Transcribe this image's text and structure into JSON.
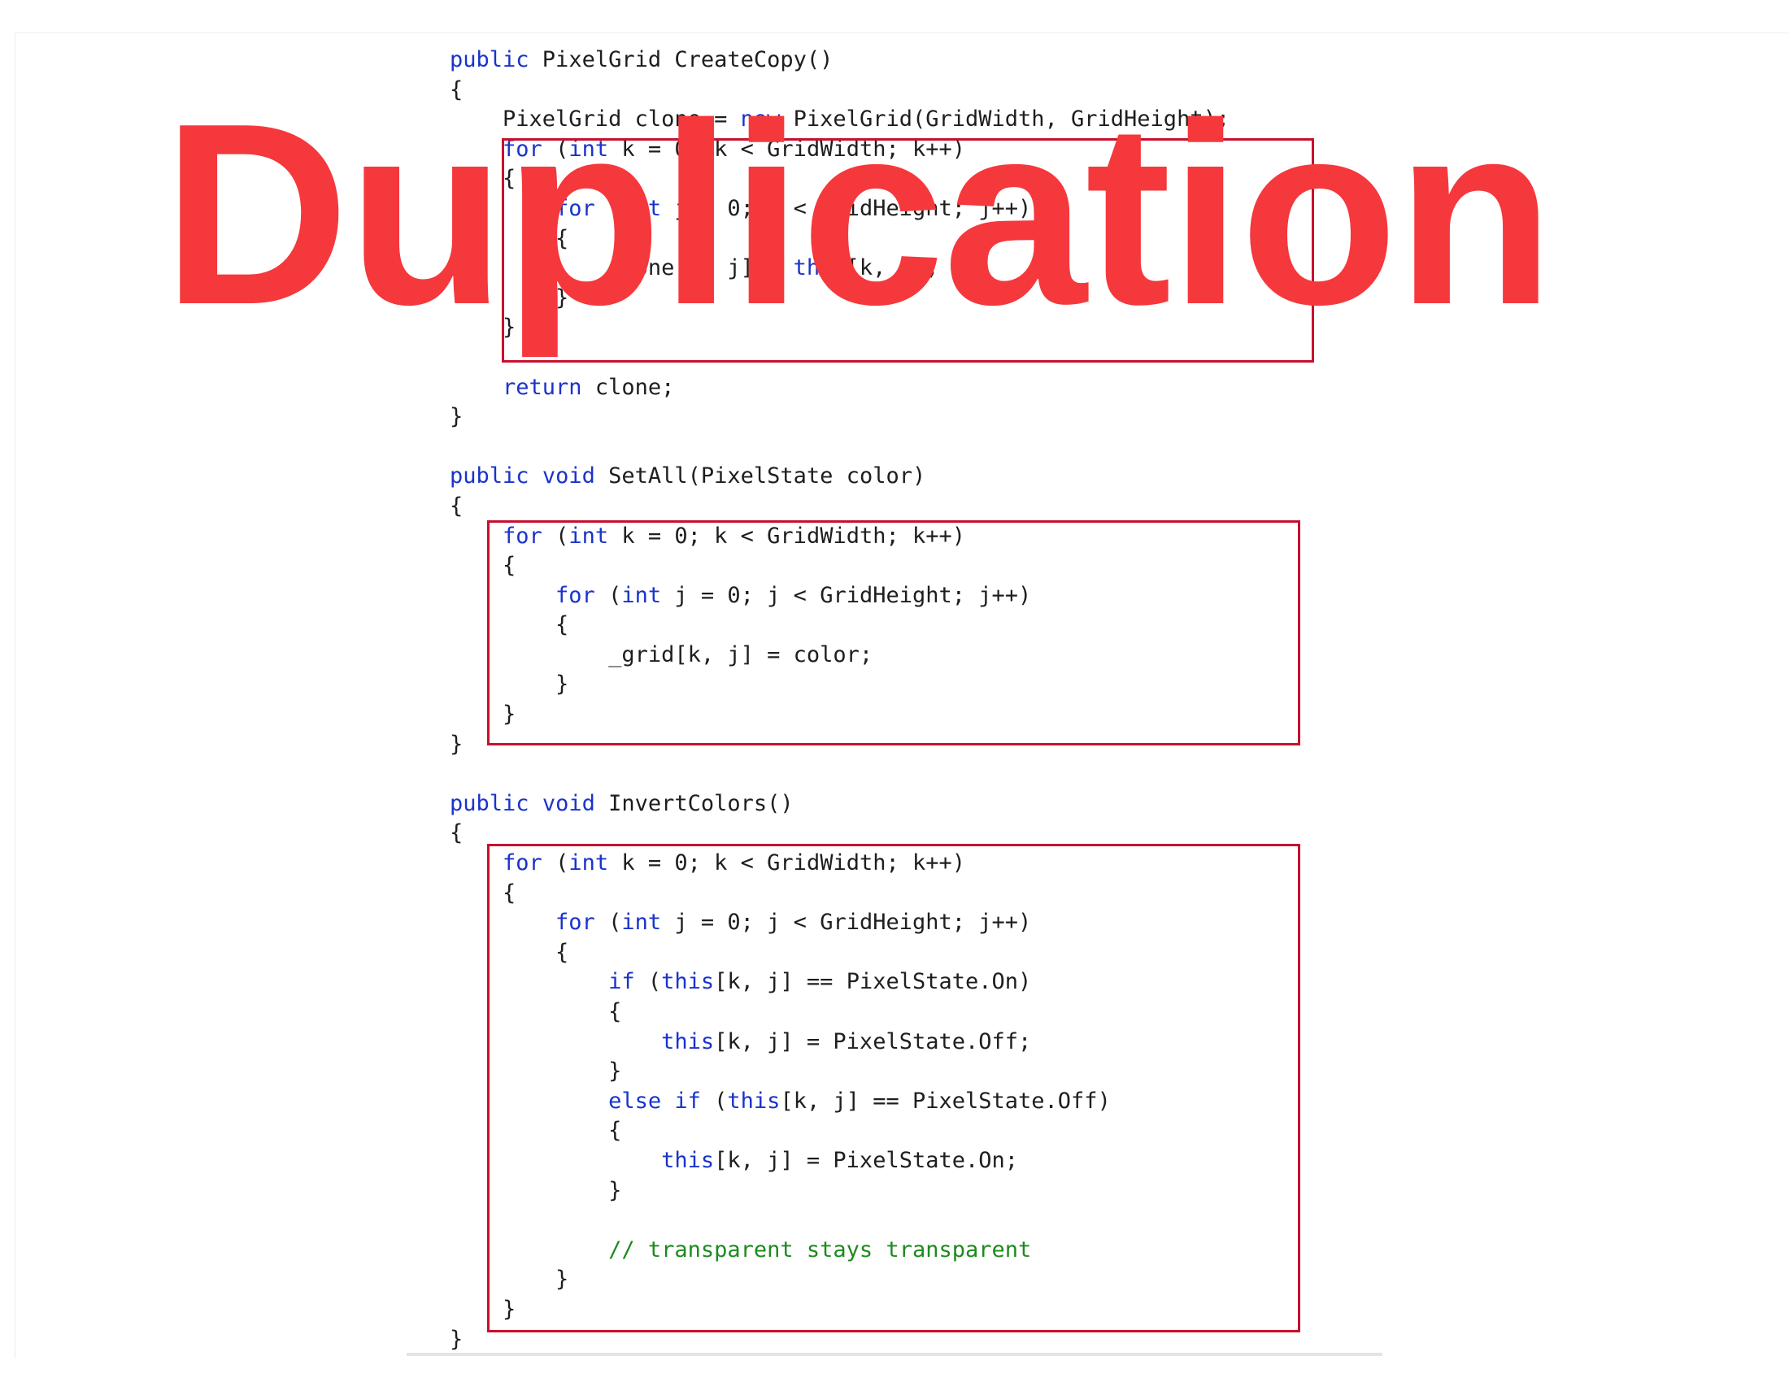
{
  "overlay": {
    "title": "Duplication",
    "color": "#f5383c"
  },
  "colors": {
    "keyword": "#1a33cc",
    "comment": "#1e8a1e",
    "text": "#1e1e1e",
    "highlight_box": "#c8102e"
  },
  "code_lines": [
    [
      {
        "t": "public",
        "c": "kw"
      },
      {
        "t": " PixelGrid CreateCopy()"
      }
    ],
    [
      {
        "t": "{"
      }
    ],
    [
      {
        "t": "    PixelGrid clone = "
      },
      {
        "t": "new",
        "c": "kw"
      },
      {
        "t": " PixelGrid(GridWidth, GridHeight);"
      }
    ],
    [
      {
        "t": "    "
      },
      {
        "t": "for",
        "c": "kw"
      },
      {
        "t": " ("
      },
      {
        "t": "int",
        "c": "kw"
      },
      {
        "t": " k = 0; k < GridWidth; k++)"
      }
    ],
    [
      {
        "t": "    {"
      }
    ],
    [
      {
        "t": "        "
      },
      {
        "t": "for",
        "c": "kw"
      },
      {
        "t": " ("
      },
      {
        "t": "int",
        "c": "kw"
      },
      {
        "t": " j = 0; j < GridHeight; j++)"
      }
    ],
    [
      {
        "t": "        {"
      }
    ],
    [
      {
        "t": "            clone[k, j] = "
      },
      {
        "t": "this",
        "c": "kw"
      },
      {
        "t": "[k, j];"
      }
    ],
    [
      {
        "t": "        }"
      }
    ],
    [
      {
        "t": "    }"
      }
    ],
    [
      {
        "t": ""
      }
    ],
    [
      {
        "t": "    "
      },
      {
        "t": "return",
        "c": "kw"
      },
      {
        "t": " clone;"
      }
    ],
    [
      {
        "t": "}"
      }
    ],
    [
      {
        "t": ""
      }
    ],
    [
      {
        "t": "public",
        "c": "kw"
      },
      {
        "t": " "
      },
      {
        "t": "void",
        "c": "kw"
      },
      {
        "t": " SetAll(PixelState color)"
      }
    ],
    [
      {
        "t": "{"
      }
    ],
    [
      {
        "t": "    "
      },
      {
        "t": "for",
        "c": "kw"
      },
      {
        "t": " ("
      },
      {
        "t": "int",
        "c": "kw"
      },
      {
        "t": " k = 0; k < GridWidth; k++)"
      }
    ],
    [
      {
        "t": "    {"
      }
    ],
    [
      {
        "t": "        "
      },
      {
        "t": "for",
        "c": "kw"
      },
      {
        "t": " ("
      },
      {
        "t": "int",
        "c": "kw"
      },
      {
        "t": " j = 0; j < GridHeight; j++)"
      }
    ],
    [
      {
        "t": "        {"
      }
    ],
    [
      {
        "t": "            _grid[k, j] = color;"
      }
    ],
    [
      {
        "t": "        }"
      }
    ],
    [
      {
        "t": "    }"
      }
    ],
    [
      {
        "t": "}"
      }
    ],
    [
      {
        "t": ""
      }
    ],
    [
      {
        "t": "public",
        "c": "kw"
      },
      {
        "t": " "
      },
      {
        "t": "void",
        "c": "kw"
      },
      {
        "t": " InvertColors()"
      }
    ],
    [
      {
        "t": "{"
      }
    ],
    [
      {
        "t": "    "
      },
      {
        "t": "for",
        "c": "kw"
      },
      {
        "t": " ("
      },
      {
        "t": "int",
        "c": "kw"
      },
      {
        "t": " k = 0; k < GridWidth; k++)"
      }
    ],
    [
      {
        "t": "    {"
      }
    ],
    [
      {
        "t": "        "
      },
      {
        "t": "for",
        "c": "kw"
      },
      {
        "t": " ("
      },
      {
        "t": "int",
        "c": "kw"
      },
      {
        "t": " j = 0; j < GridHeight; j++)"
      }
    ],
    [
      {
        "t": "        {"
      }
    ],
    [
      {
        "t": "            "
      },
      {
        "t": "if",
        "c": "kw"
      },
      {
        "t": " ("
      },
      {
        "t": "this",
        "c": "kw"
      },
      {
        "t": "[k, j] == PixelState.On)"
      }
    ],
    [
      {
        "t": "            {"
      }
    ],
    [
      {
        "t": "                "
      },
      {
        "t": "this",
        "c": "kw"
      },
      {
        "t": "[k, j] = PixelState.Off;"
      }
    ],
    [
      {
        "t": "            }"
      }
    ],
    [
      {
        "t": "            "
      },
      {
        "t": "else",
        "c": "kw"
      },
      {
        "t": " "
      },
      {
        "t": "if",
        "c": "kw"
      },
      {
        "t": " ("
      },
      {
        "t": "this",
        "c": "kw"
      },
      {
        "t": "[k, j] == PixelState.Off)"
      }
    ],
    [
      {
        "t": "            {"
      }
    ],
    [
      {
        "t": "                "
      },
      {
        "t": "this",
        "c": "kw"
      },
      {
        "t": "[k, j] = PixelState.On;"
      }
    ],
    [
      {
        "t": "            }"
      }
    ],
    [
      {
        "t": ""
      }
    ],
    [
      {
        "t": "            "
      },
      {
        "t": "// transparent stays transparent",
        "c": "cm"
      }
    ],
    [
      {
        "t": "        }"
      }
    ],
    [
      {
        "t": "    }"
      }
    ],
    [
      {
        "t": "}"
      }
    ]
  ]
}
